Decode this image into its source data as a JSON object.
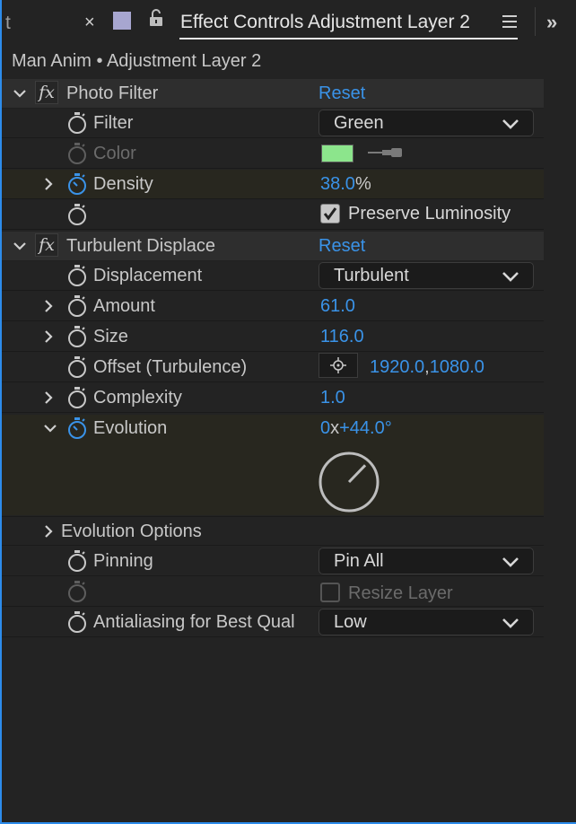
{
  "tab": {
    "truncated_label": "t",
    "close": "×",
    "swatch_color": "#a7a6d0",
    "title": "Effect Controls Adjustment Layer 2",
    "menu_icon": "hamburger-icon",
    "overflow": "»"
  },
  "layer_title": "Man Anim • Adjustment Layer 2",
  "effects": {
    "photo_filter": {
      "name": "Photo Filter",
      "reset": "Reset",
      "filter_label": "Filter",
      "filter_value": "Green",
      "color_label": "Color",
      "color_value": "#8ce58c",
      "density_label": "Density",
      "density_value": "38.0",
      "density_unit": "%",
      "preserve_label": "Preserve Luminosity",
      "preserve_checked": true
    },
    "turbulent_displace": {
      "name": "Turbulent Displace",
      "reset": "Reset",
      "displacement_label": "Displacement",
      "displacement_value": "Turbulent",
      "amount_label": "Amount",
      "amount_value": "61.0",
      "size_label": "Size",
      "size_value": "116.0",
      "offset_label": "Offset (Turbulence)",
      "offset_x": "1920.0",
      "offset_sep": ",",
      "offset_y": "1080.0",
      "complexity_label": "Complexity",
      "complexity_value": "1.0",
      "evolution_label": "Evolution",
      "evolution_rev": "0",
      "evolution_x": "x",
      "evolution_deg": "+44.0°",
      "evolution_angle": 44,
      "evo_options_label": "Evolution Options",
      "pinning_label": "Pinning",
      "pinning_value": "Pin All",
      "resize_label": "Resize Layer",
      "resize_checked": false,
      "antialias_label": "Antialiasing for Best Qual",
      "antialias_value": "Low"
    }
  }
}
